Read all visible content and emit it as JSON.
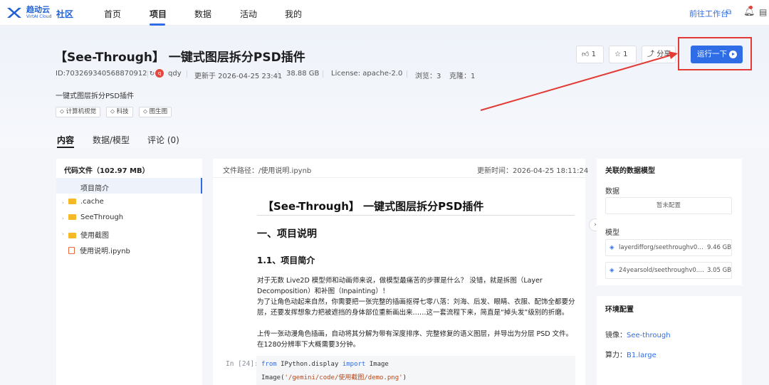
{
  "topbar": {
    "logo_text": "趋动云",
    "logo_sub": "VirtAI Cloud",
    "community": "社区",
    "nav": [
      "首页",
      "项目",
      "数据",
      "活动",
      "我的"
    ],
    "active_nav": "项目",
    "goto_workbench": "前往工作台"
  },
  "project": {
    "title": "【See-Through】 一键式图层拆分PSD插件",
    "id": "ID:703269340568870912",
    "author_initial": "q",
    "author": "qdy",
    "updated": "更新于 2026-04-25 23:41",
    "size": "38.88 GB",
    "license": "License:  apache-2.0",
    "views": "浏览：3",
    "clones": "克隆：1",
    "description": "一键式图层拆分PSD插件",
    "tags": [
      "计算机视觉",
      "科技",
      "图生图"
    ]
  },
  "actions": {
    "like": "1",
    "star": "1",
    "share": "分享",
    "run": "运行一下"
  },
  "tabs": [
    "内容",
    "数据/模型",
    "评论 (0)"
  ],
  "filetree": {
    "title": "代码文件（102.97 MB）",
    "items": [
      "项目简介",
      ".cache",
      "SeeThrough",
      "使用截图",
      "使用说明.ipynb"
    ]
  },
  "viewer": {
    "path": "文件路径：/使用说明.ipynb",
    "updated": "更新时间：2026-04-25 18:11:24",
    "h1": "【See-Through】 一键式图层拆分PSD插件",
    "h2": "一、项目说明",
    "h3": "1.1、项目简介",
    "p1": "对于无数 Live2D 模型师和动画师来说，做模型最痛苦的步骤是什么？ 没错，就是拆图（Layer Decomposition）和补图（Inpainting）！",
    "p2": "为了让角色动起来自然，你需要把一张完整的插画抠得七零八落：刘海、后发、眼睛、衣服、配饰全都要分层，还要发挥想象力把被遮挡的身体部位重新画出来……这一套流程下来，简直是“掉头发”级别的折磨。",
    "p3": "上传一张动漫角色插画，自动将其分解为带有深度排序、完整修复的语义图层，并导出为分层 PSD 文件。在1280分辨率下大概需要3分钟。",
    "in_label": "In [24]:",
    "code_kw1": "from",
    "code_mod": "IPython.display",
    "code_kw2": "import",
    "code_cls": "Image",
    "code_line2_fn": "Image(",
    "code_line2_str": "'/gemini/code/使用截图/demo.png'",
    "code_line2_end": ")"
  },
  "related": {
    "title": "关联的数据模型",
    "data_label": "数据",
    "data_empty": "暂未配置",
    "model_label": "模型",
    "models": [
      {
        "name": "layerdifforg/seethroughv0…",
        "size": "9.46 GB"
      },
      {
        "name": "24yearsold/seethroughv0.…",
        "size": "3.05 GB"
      }
    ]
  },
  "env": {
    "title": "环境配置",
    "image_label": "镜像：",
    "image_value": "See-through",
    "compute_label": "算力：",
    "compute_value": "B1.large"
  },
  "colors": {
    "accent": "#2f6de6",
    "annotation": "#e23b35"
  }
}
